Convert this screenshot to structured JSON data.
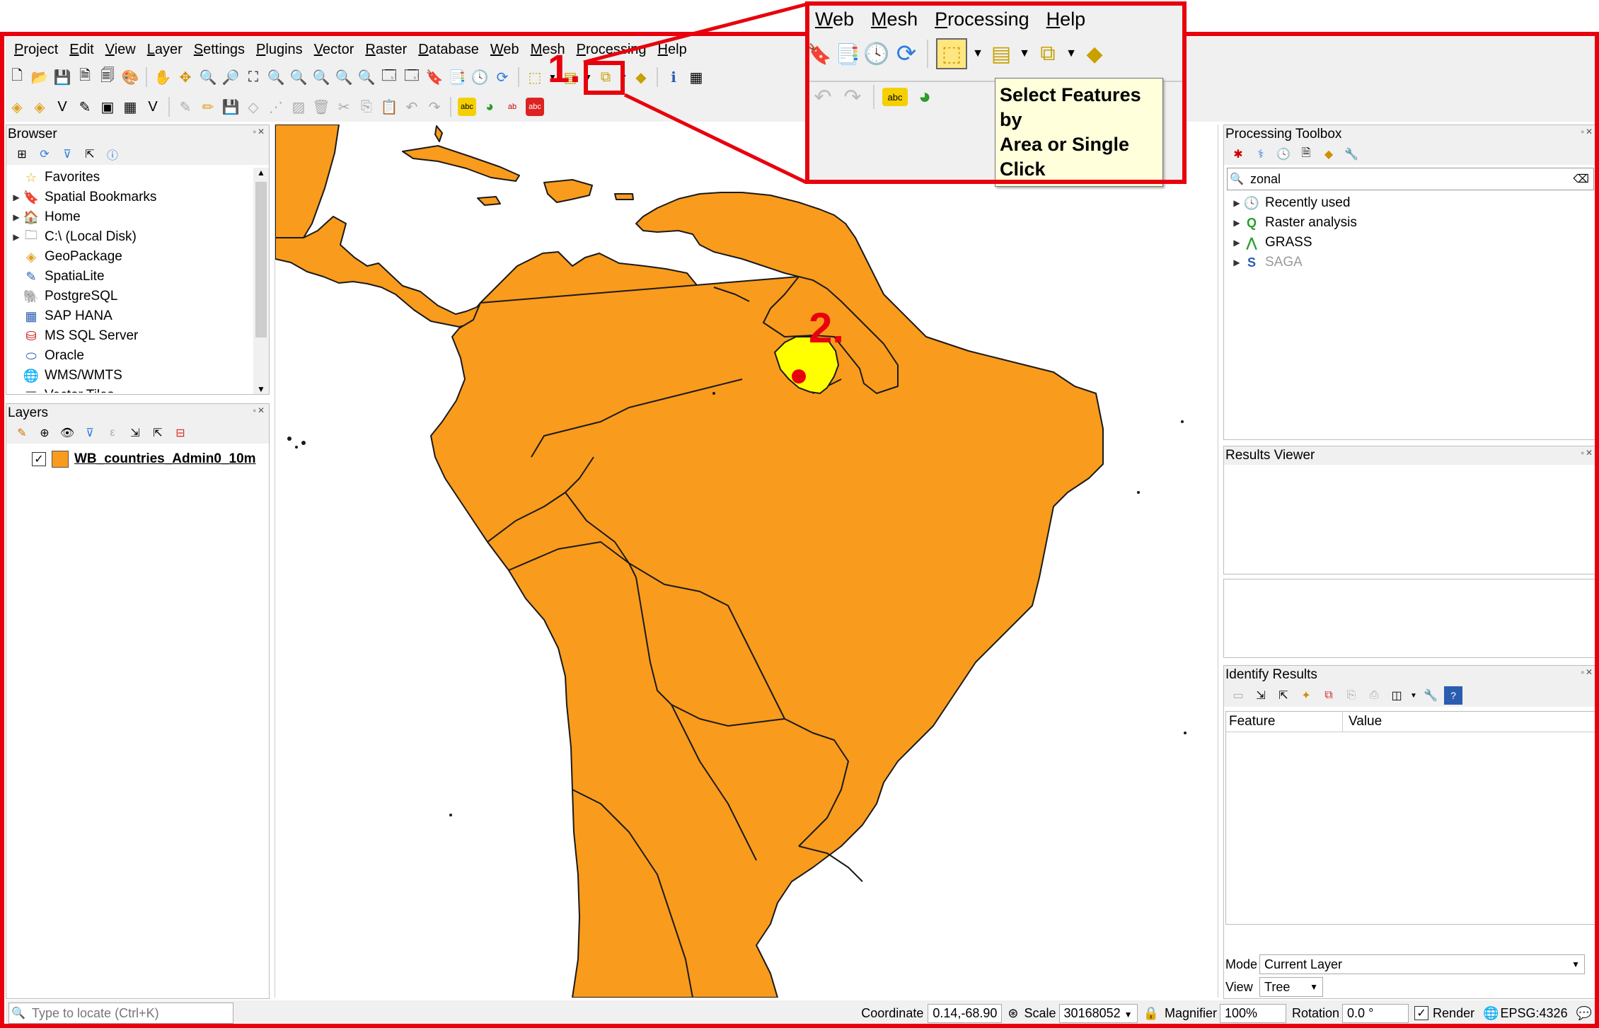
{
  "menu": [
    "Project",
    "Edit",
    "View",
    "Layer",
    "Settings",
    "Plugins",
    "Vector",
    "Raster",
    "Database",
    "Web",
    "Mesh",
    "Processing",
    "Help"
  ],
  "browser": {
    "title": "Browser",
    "items": [
      {
        "label": "Favorites",
        "icon": "star-icon",
        "expand": false
      },
      {
        "label": "Spatial Bookmarks",
        "icon": "bookmark-icon",
        "expand": true
      },
      {
        "label": "Home",
        "icon": "home-folder-icon",
        "expand": true
      },
      {
        "label": "C:\\ (Local Disk)",
        "icon": "folder-icon",
        "expand": true
      },
      {
        "label": "GeoPackage",
        "icon": "geopackage-icon",
        "expand": false
      },
      {
        "label": "SpatiaLite",
        "icon": "spatialite-icon",
        "expand": false
      },
      {
        "label": "PostgreSQL",
        "icon": "postgresql-icon",
        "expand": false
      },
      {
        "label": "SAP HANA",
        "icon": "sap-hana-icon",
        "expand": false
      },
      {
        "label": "MS SQL Server",
        "icon": "mssql-icon",
        "expand": false
      },
      {
        "label": "Oracle",
        "icon": "oracle-icon",
        "expand": false
      },
      {
        "label": "WMS/WMTS",
        "icon": "wms-icon",
        "expand": false
      },
      {
        "label": "Vector Tiles",
        "icon": "vector-tiles-icon",
        "expand": false
      }
    ]
  },
  "layers": {
    "title": "Layers",
    "layer_name": "WB_countries_Admin0_10m",
    "layer_color": "#f99b1c"
  },
  "processing": {
    "title": "Processing Toolbox",
    "search_value": "zonal",
    "items": [
      {
        "label": "Recently used",
        "icon": "clock-icon",
        "muted": false
      },
      {
        "label": "Raster analysis",
        "icon": "qgis-icon",
        "muted": false
      },
      {
        "label": "GRASS",
        "icon": "grass-icon",
        "muted": false
      },
      {
        "label": "SAGA",
        "icon": "saga-icon",
        "muted": true
      }
    ]
  },
  "results_viewer": {
    "title": "Results Viewer"
  },
  "identify": {
    "title": "Identify Results",
    "columns": [
      "Feature",
      "Value"
    ],
    "mode_label": "Mode",
    "mode_value": "Current Layer",
    "view_label": "View",
    "view_value": "Tree"
  },
  "callout": {
    "menu": [
      "Web",
      "Mesh",
      "Processing",
      "Help"
    ],
    "tooltip": [
      "Select Features by",
      "Area or Single",
      "Click"
    ]
  },
  "markers": {
    "step1": "1.",
    "step2": "2."
  },
  "status": {
    "locate_placeholder": "Type to locate (Ctrl+K)",
    "coordinate_label": "Coordinate",
    "coordinate_value": "0.14,-68.90",
    "scale_label": "Scale",
    "scale_value": "30168052",
    "magnifier_label": "Magnifier",
    "magnifier_value": "100%",
    "rotation_label": "Rotation",
    "rotation_value": "0.0 °",
    "render_label": "Render",
    "crs": "EPSG:4326"
  },
  "colors": {
    "country_fill": "#f99b1c",
    "selected_fill": "#ffff00",
    "annotation_red": "#e8000d"
  }
}
